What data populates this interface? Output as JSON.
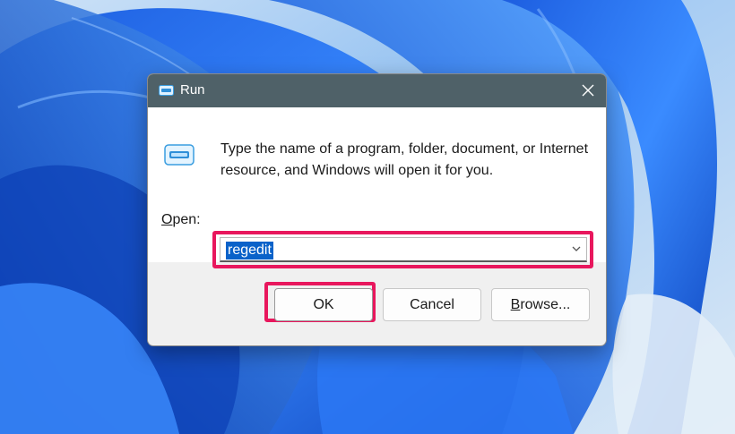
{
  "window": {
    "title": "Run",
    "description": "Type the name of a program, folder, document, or Internet resource, and Windows will open it for you.",
    "open_label": "Open:",
    "open_value": "regedit"
  },
  "buttons": {
    "ok": "OK",
    "cancel": "Cancel",
    "browse": "Browse..."
  },
  "colors": {
    "titlebar": "#4f6168",
    "highlight": "#e8175d",
    "selection": "#0a62c9",
    "wallpaper": "#2f7ff0"
  },
  "icons": {
    "title": "run-icon",
    "content": "run-icon",
    "close": "close-icon",
    "dropdown": "chevron-down-icon"
  }
}
